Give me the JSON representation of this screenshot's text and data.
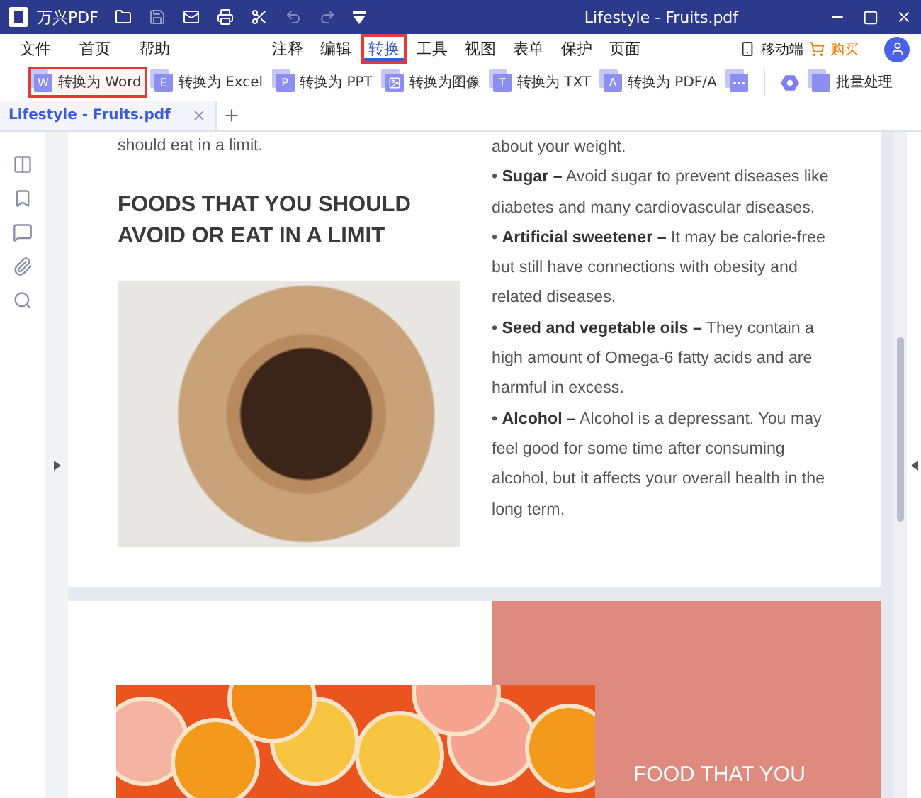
{
  "window": {
    "app_name": "万兴PDF",
    "title": "Lifestyle - Fruits.pdf"
  },
  "menu_left": [
    "文件",
    "首页",
    "帮助"
  ],
  "menu_center": [
    {
      "label": "注释",
      "selected": false,
      "highlighted": false
    },
    {
      "label": "编辑",
      "selected": false,
      "highlighted": false
    },
    {
      "label": "转换",
      "selected": true,
      "highlighted": true
    },
    {
      "label": "工具",
      "selected": false,
      "highlighted": false
    },
    {
      "label": "视图",
      "selected": false,
      "highlighted": false
    },
    {
      "label": "表单",
      "selected": false,
      "highlighted": false
    },
    {
      "label": "保护",
      "selected": false,
      "highlighted": false
    },
    {
      "label": "页面",
      "selected": false,
      "highlighted": false
    }
  ],
  "menu_right": {
    "mobile": "移动端",
    "buy": "购买"
  },
  "toolbar": [
    {
      "kind": "letter",
      "icon_letter": "W",
      "label": "转换为 Word",
      "highlighted": true
    },
    {
      "kind": "letter",
      "icon_letter": "E",
      "label": "转换为 Excel",
      "highlighted": false
    },
    {
      "kind": "letter",
      "icon_letter": "P",
      "label": "转换为 PPT",
      "highlighted": false
    },
    {
      "kind": "image",
      "label": "转换为图像",
      "highlighted": false
    },
    {
      "kind": "letter",
      "icon_letter": "T",
      "label": "转换为 TXT",
      "highlighted": false
    },
    {
      "kind": "letter",
      "icon_letter": "A",
      "label": "转换为 PDF/A",
      "highlighted": false
    },
    {
      "kind": "more",
      "highlighted": false
    },
    {
      "kind": "divider"
    },
    {
      "kind": "hexagon",
      "highlighted": false
    },
    {
      "kind": "batch",
      "label": "批量处理",
      "highlighted": false
    }
  ],
  "tabs": [
    {
      "label": "Lifestyle - Fruits.pdf",
      "selected": true
    }
  ],
  "page_1": {
    "left_intro": "should eat in a limit.",
    "heading": "FOODS THAT YOU SHOULD AVOID OR EAT IN A LIMIT",
    "right_intro": "about your weight.",
    "bullets": [
      "• **Sugar –** Avoid sugar to prevent diseases like diabetes and many cardiovascular diseases.",
      "• **Artificial sweetener –** It may be calorie-free but still have connections with obesity and related diseases.",
      "• **Seed and vegetable oils –** They contain a high amount of Omega-6 fatty acids and are harmful in excess.",
      "• **Alcohol –** Alcohol is a depressant. You may feel good for some time after consuming alcohol, but it affects your overall health in the long term."
    ]
  },
  "page_2": {
    "heading": "FOOD THAT YOU"
  }
}
